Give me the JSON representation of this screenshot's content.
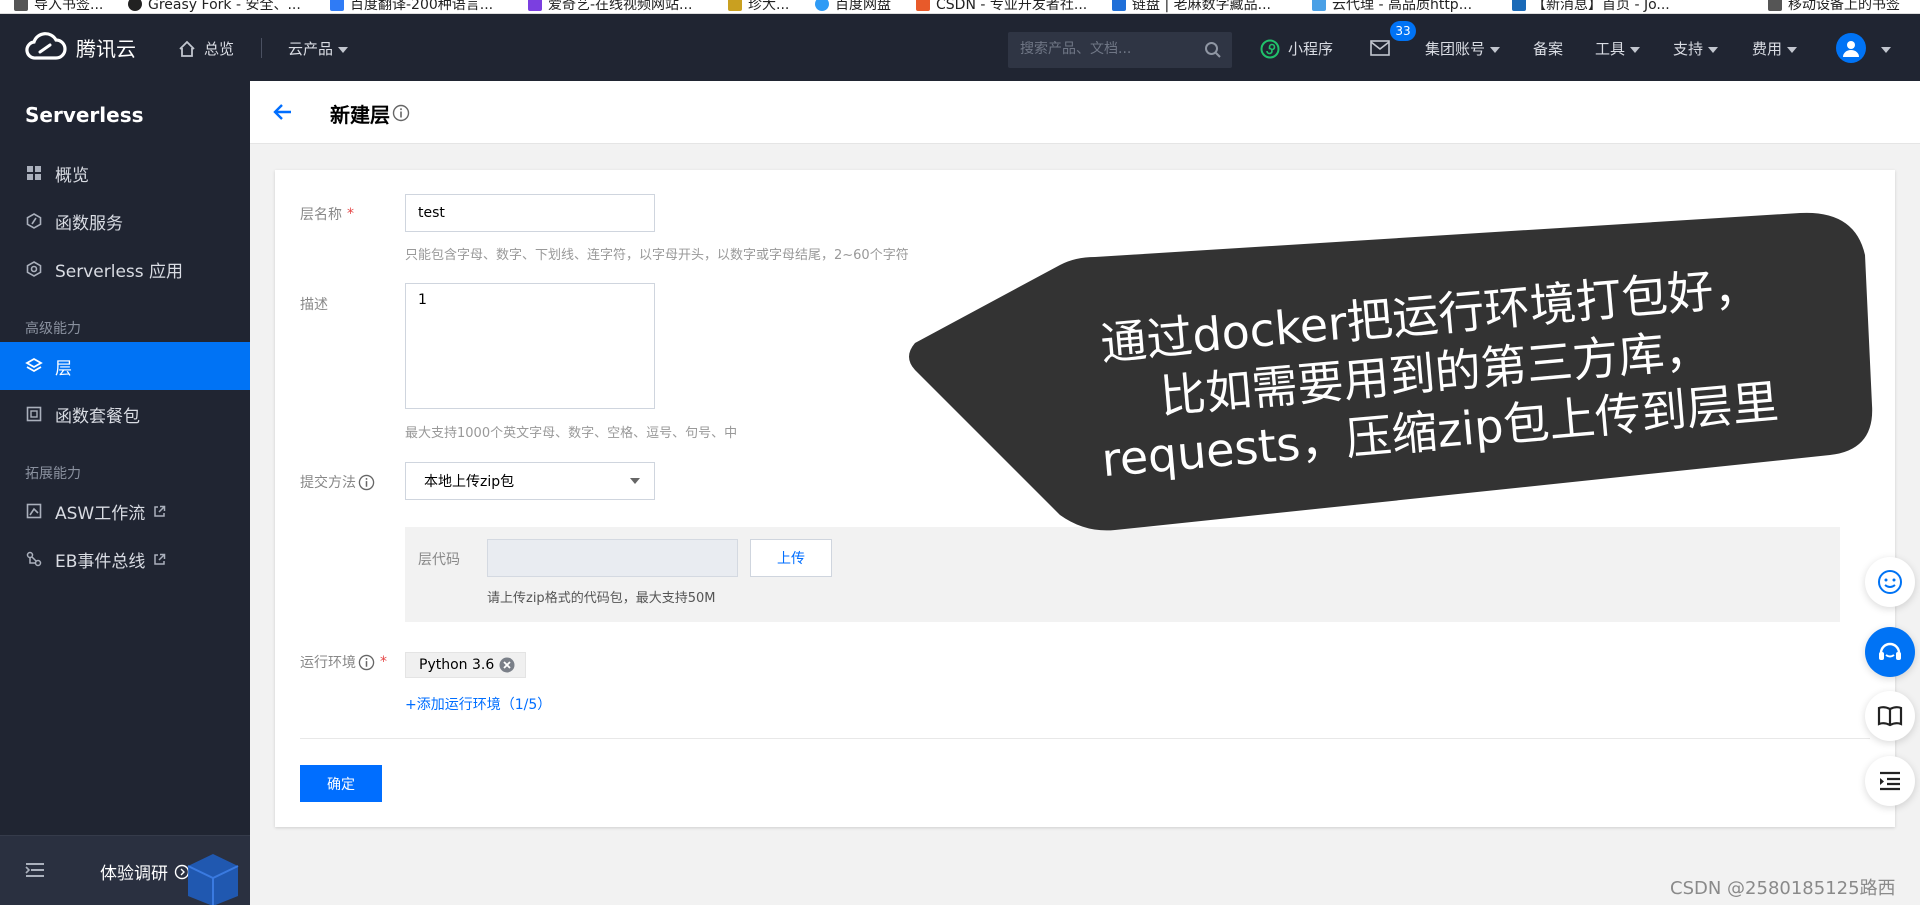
{
  "bookmarks": [
    {
      "label": "导入书签...",
      "color": "#555555"
    },
    {
      "label": "Greasy Fork - 安全、...",
      "color": "#222222"
    },
    {
      "label": "百度翻译-200种语言...",
      "color": "#2f7bf5"
    },
    {
      "label": "爱奇艺-在线视频网站...",
      "color": "#7b3fe0"
    },
    {
      "label": "珍大...",
      "color": "#c9a020"
    },
    {
      "label": "百度网盘",
      "color": "#2f9bf5"
    },
    {
      "label": "CSDN - 专业开发者社...",
      "color": "#e85a2a"
    },
    {
      "label": "链盘 | 老麻数字藏品...",
      "color": "#1f6fd8"
    },
    {
      "label": "云代理 - 高品质http...",
      "color": "#4aa0e6"
    },
    {
      "label": "【新消息】首页 - Jo...",
      "color": "#1a6ab8"
    },
    {
      "label": "移动设备上的书签",
      "color": "#555555"
    }
  ],
  "topnav": {
    "logo": "腾讯云",
    "home": "总览",
    "products": "云产品",
    "search_placeholder": "搜索产品、文档...",
    "miniprogram": "小程序",
    "mail_badge": "33",
    "group_account": "集团账号",
    "filing": "备案",
    "tools": "工具",
    "support": "支持",
    "billing": "费用"
  },
  "sidebar": {
    "title": "Serverless",
    "items_basic": [
      {
        "label": "概览",
        "icon": "grid-icon"
      },
      {
        "label": "函数服务",
        "icon": "function-icon"
      },
      {
        "label": "Serverless 应用",
        "icon": "app-icon"
      }
    ],
    "group_advanced": "高级能力",
    "items_advanced": [
      {
        "label": "层",
        "icon": "layers-icon",
        "active": true
      },
      {
        "label": "函数套餐包",
        "icon": "package-icon"
      }
    ],
    "group_extension": "拓展能力",
    "items_extension": [
      {
        "label": "ASW工作流",
        "icon": "workflow-icon"
      },
      {
        "label": "EB事件总线",
        "icon": "eventbus-icon"
      }
    ],
    "survey": "体验调研"
  },
  "page": {
    "title": "新建层"
  },
  "form": {
    "name_label": "层名称",
    "name_value": "test",
    "name_hint": "只能包含字母、数字、下划线、连字符，以字母开头，以数字或字母结尾，2~60个字符",
    "desc_label": "描述",
    "desc_value": "1",
    "desc_hint": "最大支持1000个英文字母、数字、空格、逗号、句号、中",
    "submit_method_label": "提交方法",
    "submit_method_value": "本地上传zip包",
    "code_label": "层代码",
    "upload_button": "上传",
    "upload_hint": "请上传zip格式的代码包，最大支持50M",
    "runtime_label": "运行环境",
    "runtime_tag": "Python 3.6",
    "add_runtime": "+添加运行环境（1/5）",
    "confirm_button": "确定"
  },
  "annotation": {
    "lines": [
      "通过docker把运行环境打包好，",
      "比如需要用到的第三方库，",
      "requests，压缩zip包上传到层里"
    ]
  },
  "watermark": "CSDN @2580185125路西",
  "colors": {
    "nav_bg": "#202532",
    "accent": "#006eff",
    "active_item": "#0073f5",
    "bubble": "#333333"
  }
}
